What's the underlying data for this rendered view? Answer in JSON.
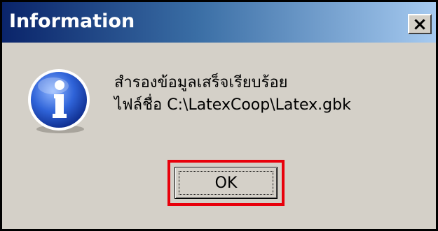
{
  "dialog": {
    "title": "Information",
    "close_symbol": "×",
    "icon": "info-icon",
    "message_lines": [
      "สำรองข้อมูลเสร็จเรียบร้อย",
      "ไฟล์ชื่อ C:\\LatexCoop\\Latex.gbk"
    ],
    "ok_label": "OK"
  },
  "colors": {
    "titlebar_start": "#0a246a",
    "titlebar_end": "#a6caf0",
    "dialog_bg": "#d4d0c8",
    "highlight": "#e8000b"
  }
}
